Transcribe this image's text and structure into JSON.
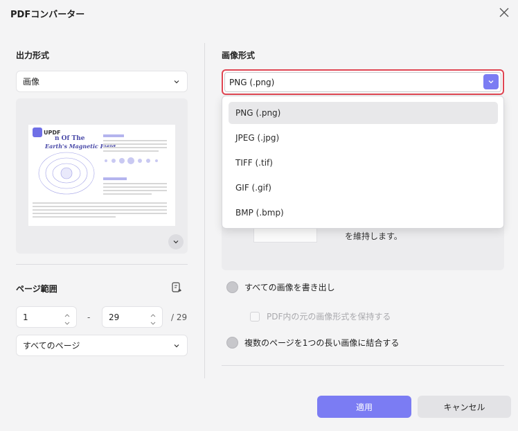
{
  "dialog": {
    "title": "PDFコンバーター"
  },
  "left": {
    "output_format_label": "出力形式",
    "output_format_value": "画像",
    "page_range_label": "ページ範囲",
    "range_from": "1",
    "range_sep": "-",
    "range_to": "29",
    "range_total": "/ 29",
    "page_scope_value": "すべてのページ"
  },
  "thumbnail": {
    "logo_text": "UPDF",
    "heading_line1": "n Of The",
    "heading_line2": "Earth's Magnetic Field"
  },
  "right": {
    "image_format_label": "画像形式",
    "format_value": "PNG (.png)",
    "format_options": [
      "PNG (.png)",
      "JPEG (.jpg)",
      "TIFF (.tif)",
      "GIF (.gif)",
      "BMP (.bmp)"
    ],
    "panel_text": "を維持します。",
    "option_export_all": "すべての画像を書き出し",
    "option_keep_format": "PDF内の元の画像形式を保持する",
    "option_combine": "複数のページを1つの長い画像に結合する"
  },
  "footer": {
    "apply_label": "適用",
    "cancel_label": "キャンセル"
  },
  "colors": {
    "accent": "#7b7cf3",
    "focus_border": "#e04552"
  }
}
